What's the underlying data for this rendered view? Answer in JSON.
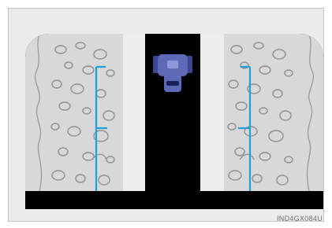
{
  "figure": {
    "caption": "IND4GX084U",
    "colors": {
      "screen": "#000000",
      "wall": "#d8d8d8",
      "wall_edge": "#ffffff",
      "guide_line": "#1ea0dd",
      "vehicle": "#5c6ab8"
    },
    "icons": [
      "vehicle-icon",
      "guide-line-left",
      "guide-line-right"
    ]
  }
}
